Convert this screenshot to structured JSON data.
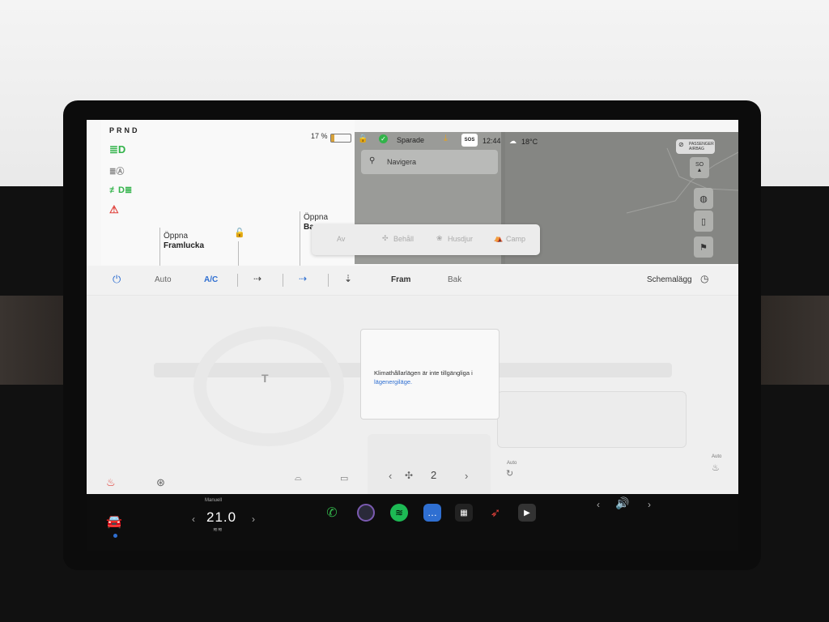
{
  "status_bar": {
    "gear": "PRND",
    "battery_percent_label": "17 %",
    "battery_level": 0.17,
    "saved_label": "Sparade",
    "sos_label": "SOS",
    "time": "12:44",
    "weather_temp": "18°C",
    "passenger_airbag_label": "PASSENGER AIRBAG"
  },
  "indicators": [
    {
      "icon": "headlight-icon",
      "color": "#32b34a"
    },
    {
      "icon": "auto-highbeam-icon",
      "color": "#888888"
    },
    {
      "icon": "fog-light-icon",
      "color": "#32b34a"
    },
    {
      "icon": "seatbelt-warning-icon",
      "color": "#e0403a"
    }
  ],
  "car_panel": {
    "front_trunk_label": "Öppna",
    "front_trunk_value": "Framlucka",
    "rear_trunk_label": "Öppna",
    "rear_trunk_value": "Ba"
  },
  "map": {
    "search_placeholder": "Navigera",
    "compass_label": "SO"
  },
  "modes": [
    {
      "label": "Av"
    },
    {
      "label": "Behåll"
    },
    {
      "label": "Husdjur"
    },
    {
      "label": "Camp"
    }
  ],
  "climate": {
    "auto_label": "Auto",
    "ac_label": "A/C",
    "front_label": "Fram",
    "rear_label": "Bak",
    "schedule_label": "Schemalägg",
    "message": "Klimathållarlägen är inte tillgängliga i",
    "message_link": "lägenergiläge.",
    "fan_speed": "2",
    "rear_auto_label": "Auto",
    "seat_auto_label": "Auto"
  },
  "dock": {
    "temp_mode": "Manuell",
    "temp_value": "21.0",
    "apps": [
      "phone-icon",
      "camera-icon",
      "spotify-icon",
      "messages-icon",
      "app-launcher-icon",
      "navigation-icon",
      "media-icon"
    ]
  },
  "colors": {
    "accent_blue": "#2f6fd1",
    "green": "#32b34a",
    "red": "#e0403a"
  }
}
